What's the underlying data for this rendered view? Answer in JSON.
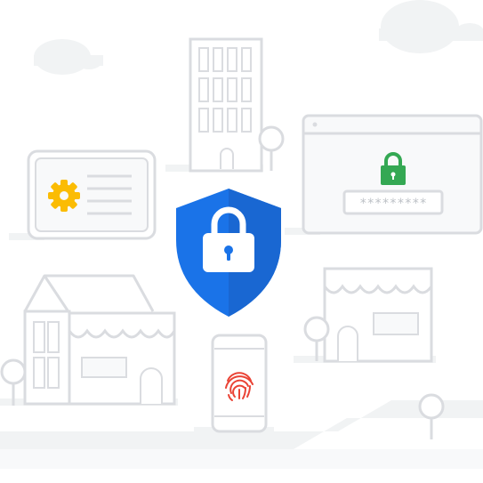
{
  "password_field": {
    "masked_text": "*********"
  },
  "icons": {
    "center": "shield-lock-icon",
    "login": "padlock-icon",
    "settings": "gear-icon",
    "biometric": "fingerprint-icon"
  },
  "colors": {
    "shield": "#1a73e8",
    "padlock": "#34a853",
    "gear": "#fbbc04",
    "fingerprint": "#ea4335",
    "outline": "#dadce0",
    "fill_light": "#f1f3f4",
    "cloud": "#f1f3f4"
  }
}
